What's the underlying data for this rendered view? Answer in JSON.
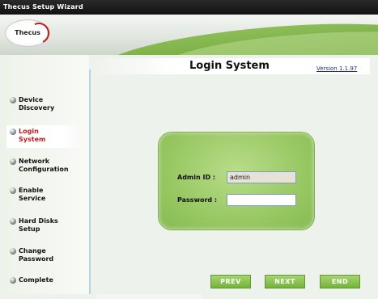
{
  "window": {
    "title": "Thecus Setup Wizard"
  },
  "logo": {
    "text": "Thecus"
  },
  "sidebar": {
    "items": [
      {
        "label": "Device\nDiscovery",
        "active": false
      },
      {
        "label": "Login\nSystem",
        "active": true
      },
      {
        "label": "Network\nConfiguration",
        "active": false
      },
      {
        "label": "Enable\nService",
        "active": false
      },
      {
        "label": "Hard Disks\nSetup",
        "active": false
      },
      {
        "label": "Change\nPassword",
        "active": false
      },
      {
        "label": "Complete",
        "active": false
      }
    ]
  },
  "main": {
    "title": "Login System",
    "version": "Version 1.1.97",
    "form": {
      "admin_id_label": "Admin ID :",
      "admin_id_value": "admin",
      "password_label": "Password :",
      "password_value": ""
    }
  },
  "buttons": {
    "prev": "PREV",
    "next": "NEXT",
    "end": "END"
  },
  "colors": {
    "accent_green": "#7cb342",
    "active_nav": "#c01b1b",
    "titlebar": "#1a1a1a"
  }
}
